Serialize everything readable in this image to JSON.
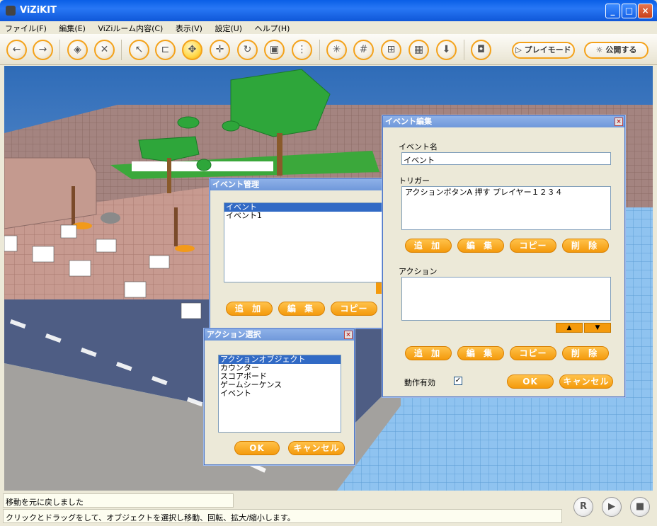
{
  "window": {
    "title": "ViZiKIT",
    "minimize": "_",
    "maximize": "□",
    "close": "×"
  },
  "menu": [
    "ファイル(F)",
    "編集(E)",
    "ViZiルーム内容(C)",
    "表示(V)",
    "設定(U)",
    "ヘルプ(H)"
  ],
  "toolbar": {
    "buttons": [
      "back-icon",
      "forward-icon",
      "object-icon",
      "delete-icon",
      "pointer-icon",
      "hierarchy-icon",
      "select-icon",
      "move-icon",
      "rotate-icon",
      "scale-icon",
      "align-icon",
      "axis-icon",
      "grid-icon",
      "snap-icon",
      "box-on-icon",
      "drop-icon",
      "camera-icon"
    ],
    "play_mode": "プレイモード",
    "publish": "公開する"
  },
  "event_manager": {
    "title": "イベント管理",
    "items": [
      "イベント",
      "イベント1"
    ],
    "add": "追 加",
    "edit": "編 集",
    "copy": "コピー"
  },
  "event_edit": {
    "title": "イベント編集",
    "name_label": "イベント名",
    "name_value": "イベント",
    "trigger_label": "トリガー",
    "trigger_value": "アクションボタンA 押す プレイヤー１２３４",
    "add": "追 加",
    "edit": "編 集",
    "copy": "コピー",
    "delete": "削 除",
    "action_label": "アクション",
    "up": "▲",
    "down": "▼",
    "enabled_label": "動作有効",
    "enabled_check": "✓",
    "ok": "OK",
    "cancel": "キャンセル"
  },
  "action_select": {
    "title": "アクション選択",
    "items": [
      "アクションオブジェクト",
      "カウンター",
      "スコアボード",
      "ゲームシーケンス",
      "イベント"
    ],
    "ok": "OK",
    "cancel": "キャンセル"
  },
  "status": {
    "line1": "移動を元に戻しました",
    "line2": "クリックとドラッグをして、オブジェクトを選択し移動、回転、拡大/縮小します。"
  },
  "playback": {
    "record": "R",
    "play": "▶",
    "stop": "■"
  }
}
